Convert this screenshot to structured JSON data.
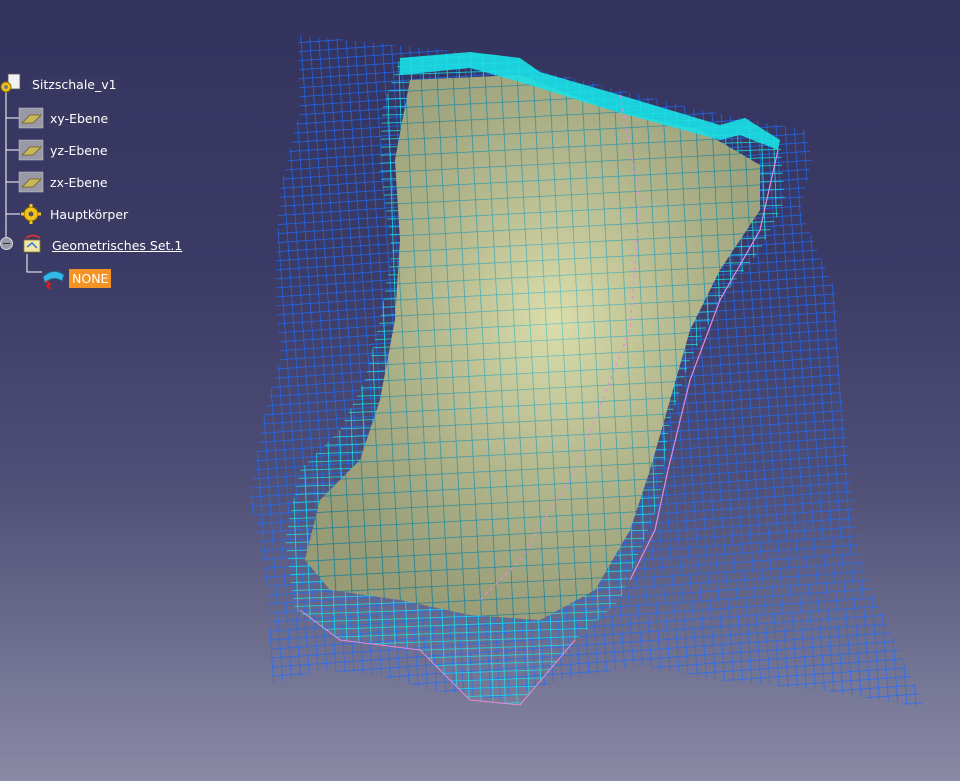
{
  "viewport": {
    "background_top": "#33335e",
    "background_bottom": "#8a8aa6",
    "mesh_outer_color": "#1e6cff",
    "mesh_inner_color": "#19e0e6",
    "surface_color": "#c9cf8e"
  },
  "tree": {
    "root": {
      "label": "Sitzschale_v1",
      "icon": "part-gear-icon"
    },
    "items": [
      {
        "label": "xy-Ebene",
        "icon": "plane-icon"
      },
      {
        "label": "yz-Ebene",
        "icon": "plane-icon"
      },
      {
        "label": "zx-Ebene",
        "icon": "plane-icon"
      },
      {
        "label": "Hauptkörper",
        "icon": "body-gear-icon"
      },
      {
        "label": "Geometrisches Set.1",
        "icon": "geometrical-set-icon"
      }
    ],
    "child": {
      "label": "NONE",
      "icon": "surface-error-icon",
      "highlight_color": "#f39324"
    }
  }
}
